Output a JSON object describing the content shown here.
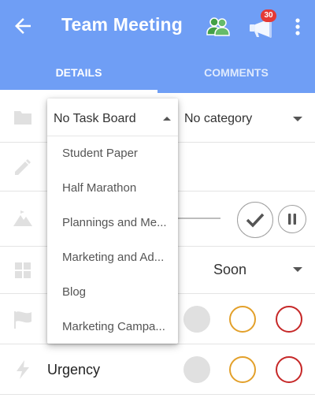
{
  "app": {
    "title": "Team Meeting",
    "notification_count": "30",
    "icons": {
      "back": "arrow-left-icon",
      "people": "people-icon",
      "megaphone": "megaphone-icon",
      "more": "more-vert-icon"
    },
    "colors": {
      "appbar": "#6f9ef5",
      "people_icon": "#4caf50",
      "badge": "#e53935"
    }
  },
  "tabs": [
    {
      "label": "DETAILS",
      "active": true
    },
    {
      "label": "COMMENTS",
      "active": false
    }
  ],
  "details": {
    "category_value": "No category",
    "due_value": "Soon",
    "urgency_label": "Urgency",
    "icons": [
      "folder-icon",
      "pencil-icon",
      "mountain-icon",
      "calendar-grid-icon",
      "flag-icon",
      "lightning-icon"
    ],
    "level_colors": {
      "none": "#e0e0e0",
      "medium": "#e3a02a",
      "high": "#c62828"
    }
  },
  "dropdown": {
    "selected": "No Task Board",
    "options": [
      "Student Paper",
      "Half Marathon",
      "Plannings and Me...",
      "Marketing and Ad...",
      "Blog",
      "Marketing Campa..."
    ]
  }
}
